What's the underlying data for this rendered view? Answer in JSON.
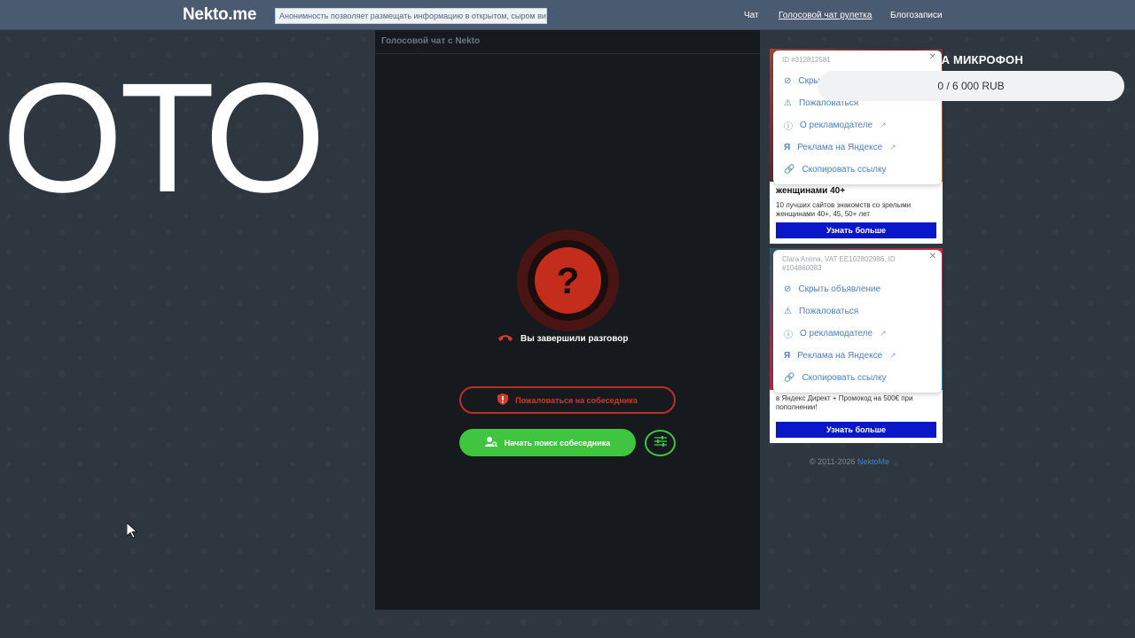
{
  "header": {
    "logo": "Nekto.me",
    "notice": "Анонимность позволяет размещать информацию в открытом, сыром виде!",
    "nav": [
      {
        "label": "Чат"
      },
      {
        "label": "Голосовой чат рулетка"
      },
      {
        "label": "Блогозаписи"
      }
    ]
  },
  "overlay": {
    "big_text": "ОТО"
  },
  "panel": {
    "title": "Голосовой чат с Nekto",
    "status_symbol": "?",
    "ended_text": "Вы завершили разговор",
    "report_label": "Пожаловаться на собеседника",
    "start_label": "Начать поиск собеседника"
  },
  "ad1": {
    "meta": "ID #312812581",
    "menu": [
      "Скрыть объявление",
      "Пожаловаться",
      "О рекламодателе",
      "Реклама на Яндексе",
      "Скопировать ссылку"
    ],
    "heading": "женщинами 40+",
    "text": "10 лучших сайтов знакомств со зрелыми женщинами 40+, 45, 50+ лет",
    "cta": "Узнать больше"
  },
  "ad2": {
    "meta": "Clara Anima, VAT EE102802986, ID #104860083",
    "menu": [
      "Скрыть объявление",
      "Пожаловаться",
      "О рекламодателе",
      "Реклама на Яндексе",
      "Скопировать ссылку"
    ],
    "text": "в Яндекс Директ + Промокод на 500€ при пополнении!",
    "cta": "Узнать больше"
  },
  "footer": {
    "copyright": "© 2011-2026",
    "link": "NektoMe"
  },
  "donation": {
    "title": "НА МИКРОФОН",
    "progress": "0 / 6 000 RUB"
  },
  "colors": {
    "accent_green": "#3fc540",
    "danger_red": "#c42c1c",
    "ad_button": "#0a17c8"
  }
}
